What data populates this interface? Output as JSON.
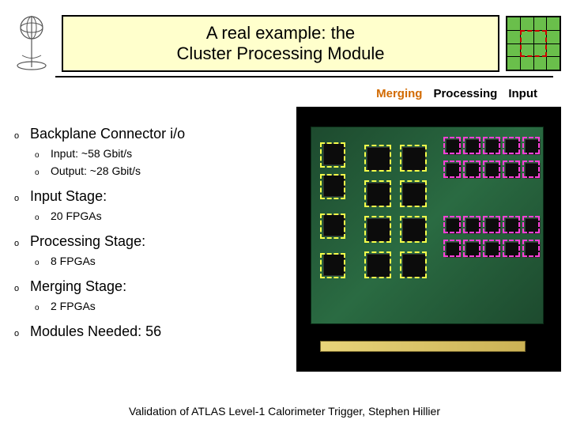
{
  "title_line1": "A real example: the",
  "title_line2": "Cluster Processing Module",
  "labels": {
    "merging": "Merging",
    "processing": "Processing",
    "input": "Input"
  },
  "sections": {
    "backplane": {
      "heading": "Backplane Connector i/o",
      "sub1": "Input: ~58 Gbit/s",
      "sub2": "Output: ~28 Gbit/s"
    },
    "input_stage": {
      "heading": "Input Stage:",
      "sub1": "20 FPGAs"
    },
    "processing_stage": {
      "heading": "Processing Stage:",
      "sub1": "8 FPGAs"
    },
    "merging_stage": {
      "heading": "Merging Stage:",
      "sub1": "2 FPGAs"
    },
    "modules_needed": {
      "heading": "Modules Needed: 56"
    }
  },
  "footer": "Validation of ATLAS Level-1 Calorimeter Trigger,   Stephen Hillier",
  "bullet_char": "o"
}
